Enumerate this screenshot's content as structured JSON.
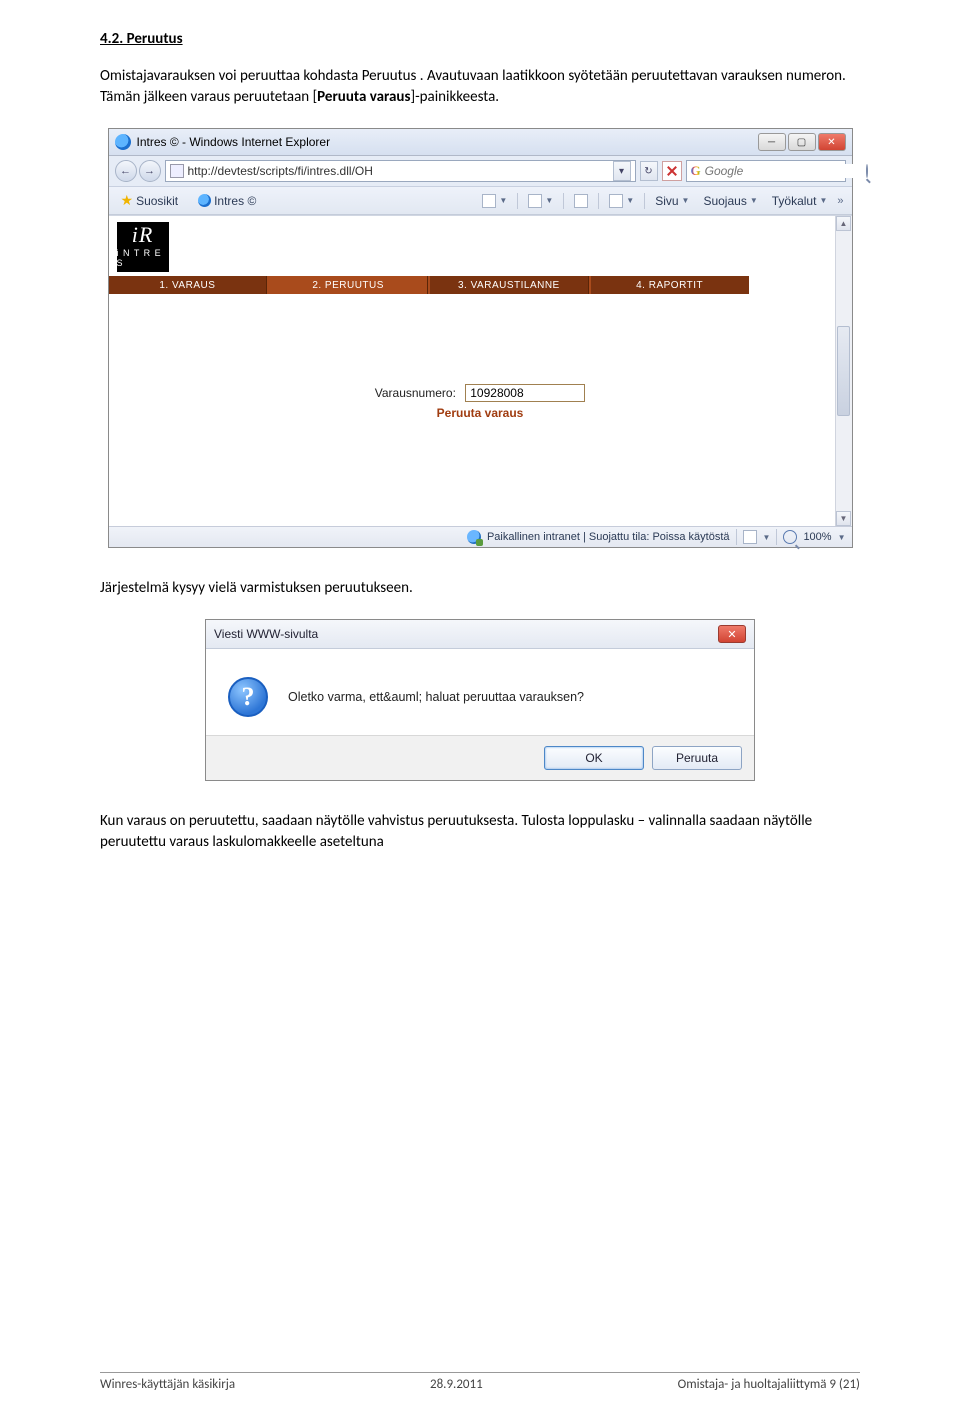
{
  "section": {
    "title": "4.2. Peruutus",
    "p1a": "Omistajavarauksen voi peruuttaa kohdasta Peruutus . Avautuvaan laatikkoon syötetään peruutettavan varauksen numeron. Tämän jälkeen varaus peruutetaan [",
    "p1b": "Peruuta varaus",
    "p1c": "]-painikkeesta.",
    "p2": "Järjestelmä kysyy vielä varmistuksen peruutukseen.",
    "p3a": "Kun varaus on peruutettu,  saadaan näytölle vahvistus peruutuksesta.  ",
    "p3b": "Tulosta loppulasku",
    "p3c": " – valinnalla saadaan näytölle peruutettu varaus laskulomakkeelle aseteltuna"
  },
  "browser": {
    "title": "Intres © - Windows Internet Explorer",
    "url": "http://devtest/scripts/fi/intres.dll/OH",
    "search_placeholder": "Google",
    "fav_label": "Suosikit",
    "tab_label": "Intres ©",
    "tool_sivu": "Sivu",
    "tool_suojaus": "Suojaus",
    "tool_tyokalut": "Työkalut",
    "logo_text": "i N T R E S",
    "tabs": [
      "1. VARAUS",
      "2. PERUUTUS",
      "3. VARAUSTILANNE",
      "4. RAPORTIT"
    ],
    "varausnumero_label": "Varausnumero:",
    "varausnumero_value": "10928008",
    "peruuta_link": "Peruuta varaus",
    "status_text": "Paikallinen intranet | Suojattu tila: Poissa käytöstä",
    "zoom_text": "100%"
  },
  "dialog": {
    "title": "Viesti WWW-sivulta",
    "message": "Oletko varma, ett&auml; haluat peruuttaa varauksen?",
    "ok": "OK",
    "cancel": "Peruuta"
  },
  "footer": {
    "left": "Winres-käyttäjän käsikirja",
    "mid": "28.9.2011",
    "right": "Omistaja- ja huoltajaliittymä 9 (21)"
  }
}
